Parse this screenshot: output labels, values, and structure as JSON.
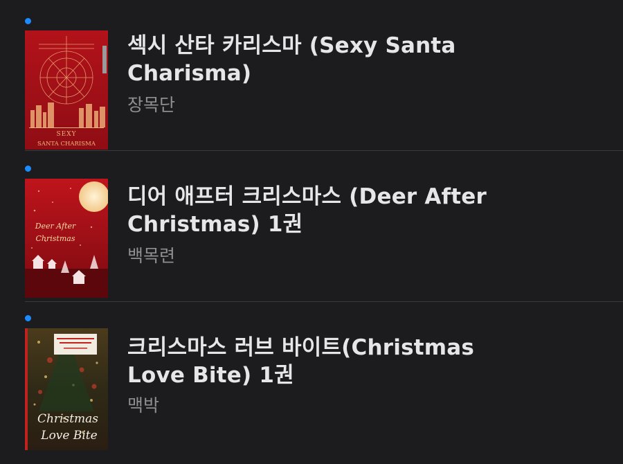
{
  "books": [
    {
      "title": "섹시 산타 카리스마 (Sexy Santa Charisma)",
      "author": "장목단",
      "cover_icon": "book-cover-sexy-santa-charisma",
      "cover_text": [
        "SEXY",
        "SANTA CHARISMA"
      ]
    },
    {
      "title": "디어 애프터 크리스마스 (Deer After Christmas) 1권",
      "author": "백목련",
      "cover_icon": "book-cover-deer-after-christmas",
      "cover_text": [
        "Deer After",
        "Christmas"
      ]
    },
    {
      "title": "크리스마스 러브 바이트(Christmas Love Bite) 1권",
      "author": "맥박",
      "cover_icon": "book-cover-christmas-love-bite",
      "cover_text": [
        "Christmas",
        "Love Bite"
      ]
    }
  ],
  "colors": {
    "background": "#1c1c1e",
    "unread_dot": "#1a8cff",
    "title": "#e6e6e8",
    "author": "#8e8e93"
  }
}
